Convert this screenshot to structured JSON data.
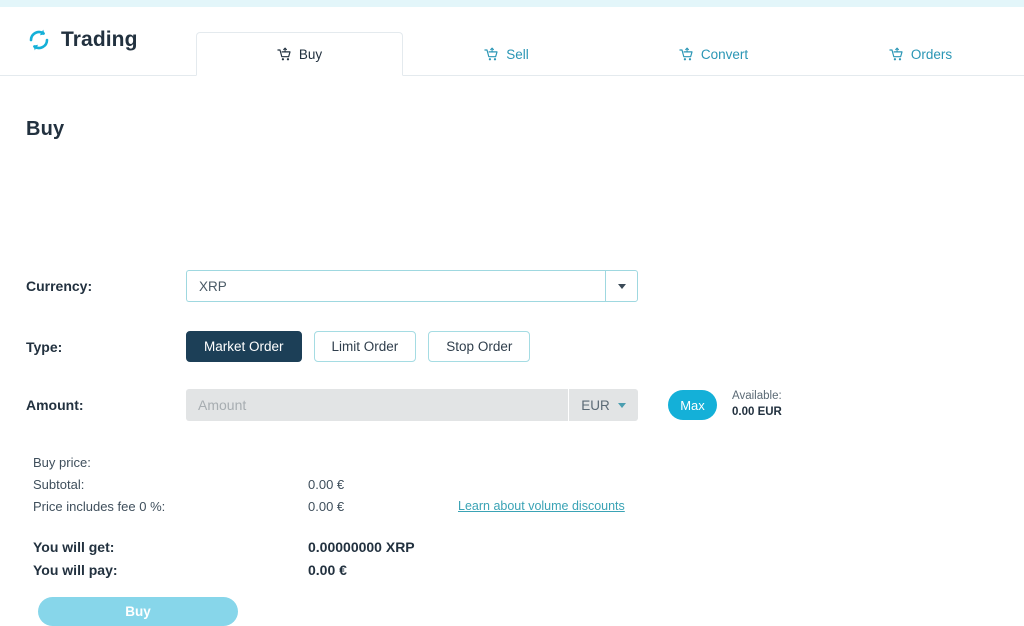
{
  "header": {
    "brand_title": "Trading",
    "logo_icon": "refresh-sync-icon",
    "tabs": [
      {
        "label": "Buy",
        "icon": "cart-icon",
        "active": true
      },
      {
        "label": "Sell",
        "icon": "cart-icon",
        "active": false
      },
      {
        "label": "Convert",
        "icon": "cart-icon",
        "active": false
      },
      {
        "label": "Orders",
        "icon": "cart-icon",
        "active": false
      }
    ]
  },
  "main": {
    "page_title": "Buy",
    "currency": {
      "label": "Currency:",
      "value": "XRP",
      "placeholder": "Currency",
      "caret_icon": "chevron-down-icon"
    },
    "type": {
      "label": "Type:",
      "options": [
        {
          "label": "Market Order",
          "selected": true
        },
        {
          "label": "Limit Order",
          "selected": false
        },
        {
          "label": "Stop Order",
          "selected": false
        }
      ]
    },
    "amount": {
      "label": "Amount:",
      "value": "",
      "placeholder": "Amount",
      "currency_code": "EUR",
      "caret_icon": "chevron-down-icon",
      "max_label": "Max",
      "available_label": "Available:",
      "available_value": "0.00 EUR"
    },
    "breakdown": [
      {
        "name": "Buy price:",
        "value": ""
      },
      {
        "name": "Subtotal:",
        "value": "0.00 €"
      },
      {
        "name": "Price includes fee 0 %:",
        "value": "0.00 €"
      }
    ],
    "volume_link": "Learn about volume discounts",
    "totals": [
      {
        "name": "You will get:",
        "value": "0.00000000 XRP"
      },
      {
        "name": "You will pay:",
        "value": "0.00 €"
      }
    ],
    "submit_label": "Buy"
  },
  "colors": {
    "accent_cyan": "#14b0d8",
    "accent_teal": "#3aa3b5",
    "dark_navy": "#1c3f57",
    "submit_cyan": "#87d6ea",
    "top_band": "#e3f6fa"
  }
}
